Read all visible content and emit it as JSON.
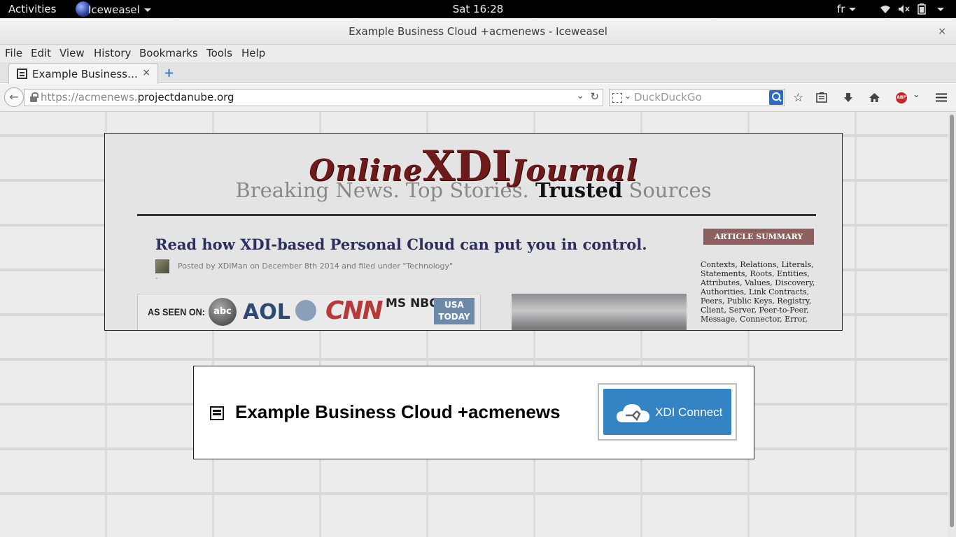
{
  "topbar": {
    "activities": "Activities",
    "app_name": "Iceweasel",
    "clock": "Sat 16:28",
    "lang": "fr"
  },
  "window": {
    "title": "Example Business Cloud +acmenews - Iceweasel",
    "close": "×"
  },
  "menu": {
    "items": [
      "File",
      "Edit",
      "View",
      "History",
      "Bookmarks",
      "Tools",
      "Help"
    ]
  },
  "tabs": [
    {
      "label": "Example Business…",
      "close": "×"
    }
  ],
  "newtab": "+",
  "nav": {
    "url_scheme": "https://acmenews.",
    "url_host": "projectdanube.org",
    "search_placeholder": "DuckDuckGo"
  },
  "journal": {
    "masthead_left": "Online",
    "masthead_mid": "XDI",
    "masthead_right": "Journal",
    "tagline_a": "Breaking News. Top Stories. ",
    "tagline_b": "Trusted",
    "tagline_c": " Sources",
    "headline": "Read how XDI-based Personal Cloud can put you in control.",
    "meta": "Posted by XDIMan on December 8th 2014 and filed under \"Technology\"",
    "dash": "-",
    "seen_label": "AS SEEN ON:",
    "logos": {
      "abc": "abc",
      "aol": "AOL",
      "cnn": "CNN",
      "msnbc": "MS NBC",
      "usa": "USA TODAY"
    },
    "summary_header": "ARTICLE SUMMARY",
    "tags": "Contexts, Relations, Literals, Statements, Roots, Entities, Attributes, Values, Discovery, Authorities, Link Contracts, Peers, Public Keys, Registry, Client, Server, Peer-to-Peer, Message, Connector, Error,"
  },
  "cloud_card": {
    "title": "Example Business Cloud +acmenews",
    "button_label": "XDI Connect"
  },
  "colors": {
    "masthead": "#6e1a1a",
    "headline": "#2c2f5e",
    "connect_button": "#3483c4",
    "summary_header": "#8d5f5f"
  }
}
